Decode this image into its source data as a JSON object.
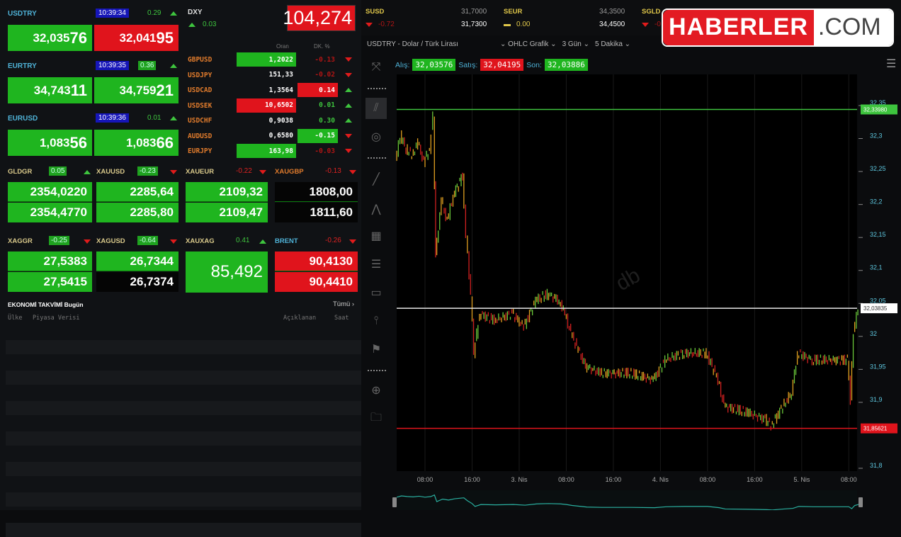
{
  "pairs": [
    {
      "symbol": "USDTRY",
      "time": "10:39:34",
      "change": "0.29",
      "boxed": false,
      "bid_main": "32,035",
      "bid_tail": "76",
      "ask_main": "32,041",
      "ask_tail": "95",
      "ask_color": "red"
    },
    {
      "symbol": "EURTRY",
      "time": "10:39:35",
      "change": "0.36",
      "boxed": true,
      "bid_main": "34,743",
      "bid_tail": "11",
      "ask_main": "34,759",
      "ask_tail": "21",
      "ask_color": "green"
    },
    {
      "symbol": "EURUSD",
      "time": "10:39:36",
      "change": "0.01",
      "boxed": false,
      "bid_main": "1,083",
      "bid_tail": "56",
      "ask_main": "1,083",
      "ask_tail": "66",
      "ask_color": "green"
    }
  ],
  "dxy": {
    "label": "DXY",
    "change": "0.03",
    "value": "104,274"
  },
  "fx_table": {
    "headers": [
      "Oran",
      "DK. %"
    ],
    "rows": [
      {
        "symbol": "GBPUSD",
        "rate": "1,2022",
        "rate_bg": "green",
        "change": "-0.13",
        "change_bg": "none",
        "dir": "down"
      },
      {
        "symbol": "USDJPY",
        "rate": "151,33",
        "rate_bg": "none",
        "change": "-0.02",
        "change_bg": "none",
        "dir": "down"
      },
      {
        "symbol": "USDCAD",
        "rate": "1,3564",
        "rate_bg": "none",
        "change": "0.14",
        "change_bg": "red",
        "dir": "up"
      },
      {
        "symbol": "USDSEK",
        "rate": "10,6502",
        "rate_bg": "red",
        "change": "0.01",
        "change_bg": "none",
        "dir": "up"
      },
      {
        "symbol": "USDCHF",
        "rate": "0,9038",
        "rate_bg": "none",
        "change": "0.30",
        "change_bg": "none",
        "dir": "up"
      },
      {
        "symbol": "AUDUSD",
        "rate": "0,6580",
        "rate_bg": "none",
        "change": "-0.15",
        "change_bg": "green",
        "dir": "down"
      },
      {
        "symbol": "EURJPY",
        "rate": "163,98",
        "rate_bg": "green",
        "change": "-0.03",
        "change_bg": "none",
        "dir": "down"
      }
    ]
  },
  "metals": [
    {
      "symbol": "GLDGR",
      "change": "0.05",
      "boxed": true,
      "dir": "up",
      "bid": "2354,0220",
      "ask": "2354,4770",
      "bid_bg": "green",
      "ask_bg": "green"
    },
    {
      "symbol": "XAUUSD",
      "change": "-0.23",
      "boxed": true,
      "dir": "down",
      "bid": "2285,64",
      "ask": "2285,80",
      "bid_bg": "green",
      "ask_bg": "green"
    },
    {
      "symbol": "XAUEUR",
      "change": "-0.22",
      "boxed": false,
      "dir": "down",
      "bid": "2109,32",
      "ask": "2109,47",
      "bid_bg": "green",
      "ask_bg": "green"
    },
    {
      "symbol": "XAUGBP",
      "change": "-0.13",
      "boxed": false,
      "dir": "down",
      "bid": "1808,00",
      "ask": "1811,60",
      "bid_bg": "black",
      "ask_bg": "black"
    },
    {
      "symbol": "XAGGR",
      "change": "-0.25",
      "boxed": true,
      "dir": "down",
      "bid": "27,5383",
      "ask": "27,5415",
      "bid_bg": "green",
      "ask_bg": "green"
    },
    {
      "symbol": "XAGUSD",
      "change": "-0.64",
      "boxed": true,
      "dir": "down",
      "bid": "26,7344",
      "ask": "26,7374",
      "bid_bg": "green",
      "ask_bg": "black"
    },
    {
      "symbol": "XAUXAG",
      "change": "0.41",
      "boxed": false,
      "dir": "up",
      "single": "85,492"
    },
    {
      "symbol": "BRENT",
      "change": "-0.26",
      "boxed": false,
      "dir": "down",
      "bid": "90,4130",
      "ask": "90,4410",
      "bid_bg": "red",
      "ask_bg": "red"
    }
  ],
  "calendar": {
    "title": "EKONOMİ TAKVİMİ",
    "today": "Bugün",
    "all": "Tümü ›",
    "columns": [
      "Ülke",
      "Piyasa Verisi",
      "Açıklanan",
      "Saat"
    ]
  },
  "ticker": [
    {
      "symbol": "SUSD",
      "bid": "31,7000",
      "ask": "31,7300",
      "change": "-0.72",
      "dir": "down"
    },
    {
      "symbol": "SEUR",
      "bid": "34,3500",
      "ask": "34,4500",
      "change": "0.00",
      "dir": "flat"
    },
    {
      "symbol": "SGLD",
      "bid": "",
      "ask": "",
      "change": "-0",
      "dir": "down"
    }
  ],
  "chart_header": {
    "title": "USDTRY - Dolar / Türk Lirası",
    "type": "OHLC Grafik",
    "range": "3 Gün",
    "interval": "5 Dakika"
  },
  "quote": {
    "bid_label": "Alış:",
    "bid": "32,03576",
    "ask_label": "Satış:",
    "ask": "32,04195",
    "last_label": "Son:",
    "last": "32,03886"
  },
  "logo": {
    "brand": "HABERLER",
    "suffix": ".COM"
  },
  "watermark": "db",
  "chart_data": {
    "type": "line",
    "title": "USDTRY - Dolar / Türk Lirası",
    "xlabel": "",
    "ylabel": "",
    "ylim": [
      31.8,
      32.35
    ],
    "y_ticks": [
      "32,35",
      "32,3",
      "32,25",
      "32,2",
      "32,15",
      "32,1",
      "32,05",
      "32",
      "31,95",
      "31,9",
      "31,8"
    ],
    "y_tick_values": [
      32.35,
      32.3,
      32.25,
      32.2,
      32.15,
      32.1,
      32.05,
      32.0,
      31.95,
      31.9,
      31.8
    ],
    "x_unit": "hours since 2 Nis 00:00",
    "x_ticks": [
      {
        "h": 8,
        "label": "08:00"
      },
      {
        "h": 16,
        "label": "16:00"
      },
      {
        "h": 24,
        "label": "3. Nis"
      },
      {
        "h": 32,
        "label": "08:00"
      },
      {
        "h": 40,
        "label": "16:00"
      },
      {
        "h": 48,
        "label": "4. Nis"
      },
      {
        "h": 56,
        "label": "08:00"
      },
      {
        "h": 64,
        "label": "16:00"
      },
      {
        "h": 72,
        "label": "5. Nis"
      },
      {
        "h": 80,
        "label": "08:00"
      }
    ],
    "xlim": [
      3.2,
      82.5
    ],
    "series": [
      {
        "name": "USDTRY",
        "points": [
          [
            3.2,
            32.26
          ],
          [
            4,
            32.3
          ],
          [
            5,
            32.28
          ],
          [
            6,
            32.27
          ],
          [
            7,
            32.29
          ],
          [
            8,
            32.26
          ],
          [
            9,
            32.28
          ],
          [
            9.6,
            32.33
          ],
          [
            10,
            32.12
          ],
          [
            11,
            32.2
          ],
          [
            12,
            32.17
          ],
          [
            13,
            32.21
          ],
          [
            14.6,
            32.24
          ],
          [
            15.2,
            32.15
          ],
          [
            16,
            32.06
          ],
          [
            16.5,
            31.97
          ],
          [
            17.5,
            32.03
          ],
          [
            20,
            32.02
          ],
          [
            23,
            32.03
          ],
          [
            25,
            32.01
          ],
          [
            27,
            32.05
          ],
          [
            29,
            32.06
          ],
          [
            31,
            32.05
          ],
          [
            32,
            32.03
          ],
          [
            33,
            32.0
          ],
          [
            34,
            31.98
          ],
          [
            35.5,
            31.95
          ],
          [
            38,
            31.94
          ],
          [
            43,
            31.94
          ],
          [
            47,
            31.93
          ],
          [
            49,
            31.96
          ],
          [
            52,
            31.97
          ],
          [
            56,
            31.97
          ],
          [
            58,
            31.93
          ],
          [
            59,
            31.89
          ],
          [
            63,
            31.88
          ],
          [
            66,
            31.87
          ],
          [
            67,
            31.86
          ],
          [
            69,
            31.89
          ],
          [
            70.5,
            31.91
          ],
          [
            71.5,
            31.97
          ],
          [
            74,
            31.96
          ],
          [
            80,
            31.96
          ],
          [
            80.5,
            31.9
          ],
          [
            81,
            32.0
          ],
          [
            81.8,
            32.04
          ]
        ]
      }
    ],
    "levels": [
      {
        "label": "32,33980",
        "value": 32.3398,
        "color": "#3ec43e"
      },
      {
        "label": "32,03835",
        "value": 32.03835,
        "color": "#e8e8e8"
      },
      {
        "label": "31,85621",
        "value": 31.85621,
        "color": "#e0141c"
      }
    ]
  }
}
